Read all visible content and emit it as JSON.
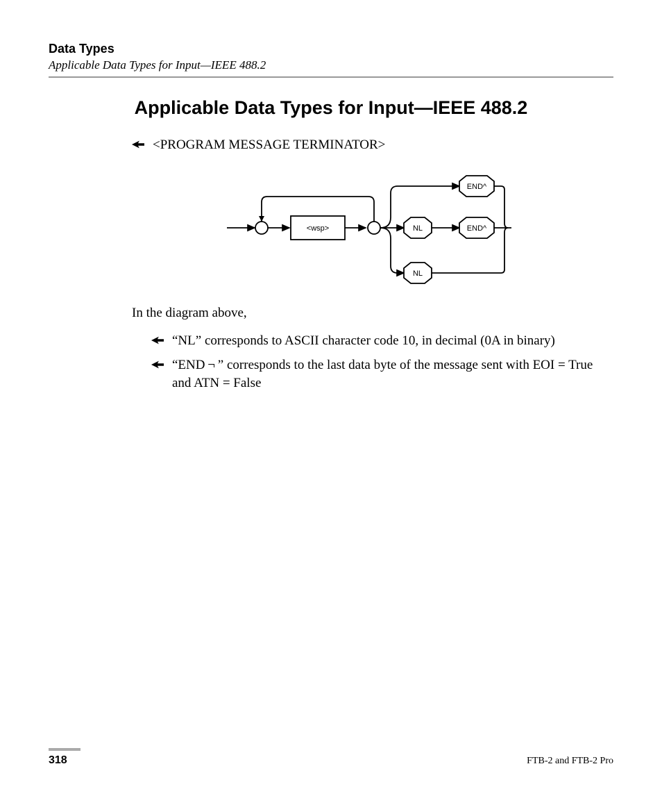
{
  "header": {
    "chapter": "Data Types",
    "section": "Applicable Data Types for Input—IEEE 488.2"
  },
  "title": "Applicable Data Types for Input—IEEE 488.2",
  "bullet1": "<PROGRAM MESSAGE TERMINATOR>",
  "diagram": {
    "wsp": "<wsp>",
    "nl1": "NL",
    "end1": "END^",
    "end2": "END^",
    "nl2": "NL"
  },
  "intro": "In the diagram above,",
  "bullet2": "“NL” corresponds to ASCII character code 10, in decimal (0A in binary)",
  "bullet3": "“END ¬ ” corresponds to the last data byte of the message sent with EOI = True and ATN =  False",
  "footer": {
    "page": "318",
    "note": "FTB-2 and FTB-2 Pro"
  }
}
